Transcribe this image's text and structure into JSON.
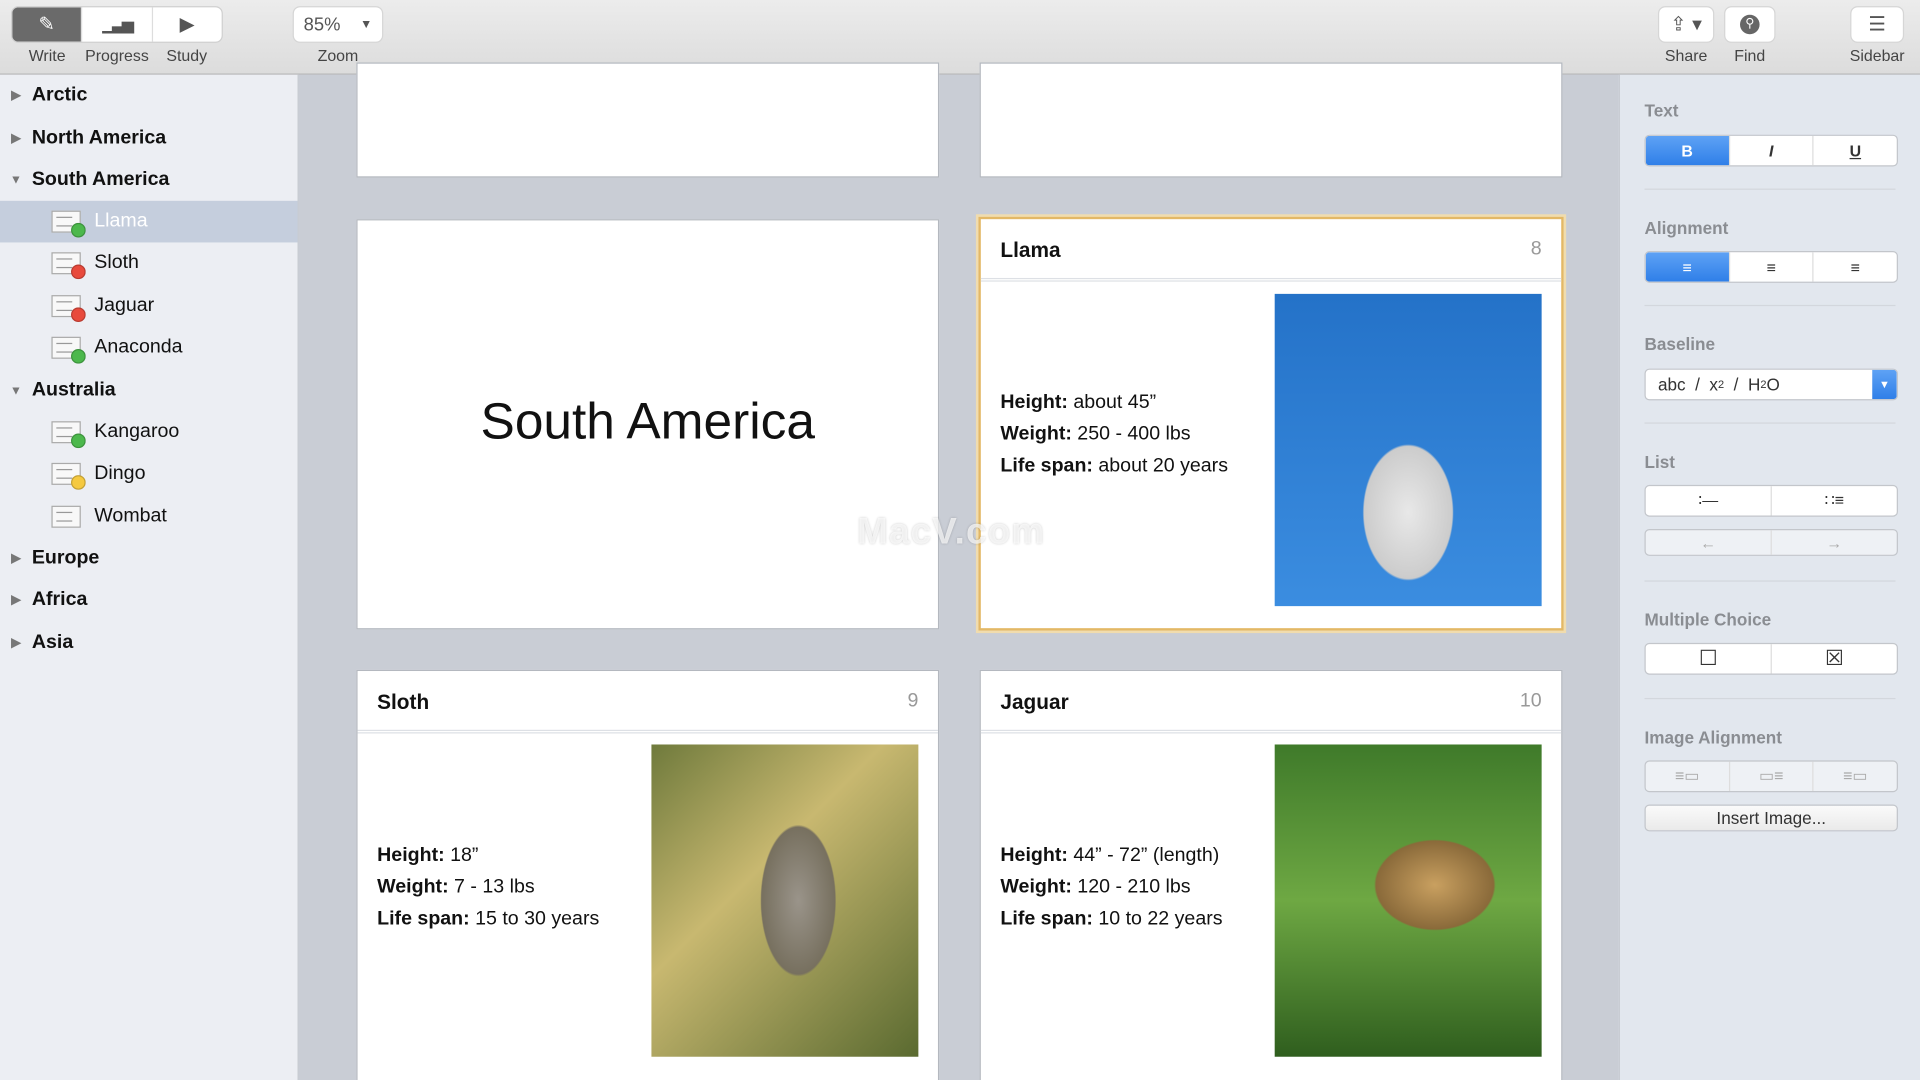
{
  "toolbar": {
    "modes": [
      {
        "label": "Write",
        "icon": "write-icon",
        "active": true
      },
      {
        "label": "Progress",
        "icon": "bar-chart-icon"
      },
      {
        "label": "Study",
        "icon": "play-icon"
      }
    ],
    "zoom": {
      "value": "85%",
      "label": "Zoom"
    },
    "share": "Share",
    "find": "Find",
    "sidebar": "Sidebar"
  },
  "sidebar": {
    "groups": [
      {
        "label": "Arctic",
        "expanded": false
      },
      {
        "label": "North America",
        "expanded": false
      },
      {
        "label": "South America",
        "expanded": true,
        "items": [
          {
            "label": "Llama",
            "status": "#4cb84c",
            "selected": true
          },
          {
            "label": "Sloth",
            "status": "#e84a3c"
          },
          {
            "label": "Jaguar",
            "status": "#e84a3c"
          },
          {
            "label": "Anaconda",
            "status": "#4cb84c"
          }
        ]
      },
      {
        "label": "Australia",
        "expanded": true,
        "items": [
          {
            "label": "Kangaroo",
            "status": "#4cb84c"
          },
          {
            "label": "Dingo",
            "status": "#f5c940"
          },
          {
            "label": "Wombat",
            "status": null
          }
        ]
      },
      {
        "label": "Europe",
        "expanded": false
      },
      {
        "label": "Africa",
        "expanded": false
      },
      {
        "label": "Asia",
        "expanded": false
      }
    ]
  },
  "cards": {
    "section_title": "South America",
    "llama": {
      "title": "Llama",
      "number": "8",
      "height_label": "Height:",
      "height": " about 45”",
      "weight_label": "Weight:",
      "weight": " 250 - 400 lbs",
      "life_label": "Life span:",
      "life": " about 20 years"
    },
    "sloth": {
      "title": "Sloth",
      "number": "9",
      "height_label": "Height:",
      "height": " 18”",
      "weight_label": "Weight:",
      "weight": " 7 - 13 lbs",
      "life_label": "Life span:",
      "life": " 15 to 30 years"
    },
    "jaguar": {
      "title": "Jaguar",
      "number": "10",
      "height_label": "Height:",
      "height": " 44” - 72” (length)",
      "weight_label": "Weight:",
      "weight": " 120 - 210 lbs",
      "life_label": "Life span:",
      "life": " 10 to 22 years"
    }
  },
  "watermark": "MacV.com",
  "inspector": {
    "text": {
      "label": "Text",
      "bold": "B",
      "italic": "I",
      "underline": "U"
    },
    "alignment": {
      "label": "Alignment",
      "left": "≡",
      "center": "≡",
      "right": "≡"
    },
    "baseline": {
      "label": "Baseline",
      "value_a": "abc  /  x",
      "sup": "2",
      "value_b": "  /  H",
      "sub": "2",
      "value_c": "O"
    },
    "list": {
      "label": "List",
      "numbered": "∶—",
      "bulleted": "∷≡",
      "outdent": "←",
      "indent": "→"
    },
    "multiple_choice": {
      "label": "Multiple Choice",
      "unchecked": "☐",
      "checked": "☒"
    },
    "image_alignment": {
      "label": "Image Alignment",
      "insert": "Insert Image..."
    }
  },
  "accent": "#2f7fe8"
}
